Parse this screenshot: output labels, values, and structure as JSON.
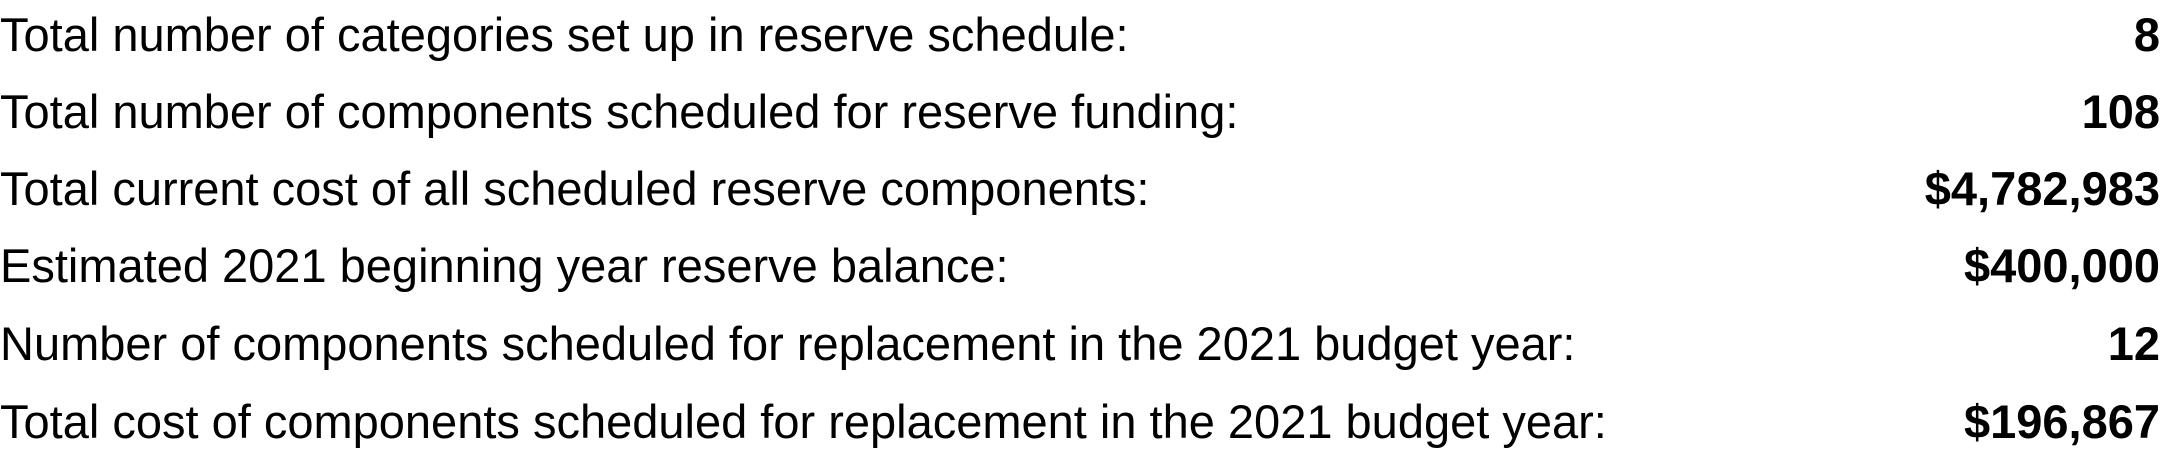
{
  "rows": [
    {
      "label": "Total number of categories set up in reserve schedule:",
      "value": "8"
    },
    {
      "label": "Total number of components scheduled for reserve funding:",
      "value": "108"
    },
    {
      "label": "Total current cost of all scheduled reserve components:",
      "value": "$4,782,983"
    },
    {
      "label": "Estimated 2021 beginning year reserve balance:",
      "value": "$400,000"
    },
    {
      "label": "Number of components scheduled for replacement in the 2021 budget year:",
      "value": "12"
    },
    {
      "label": "Total cost of components scheduled for replacement in the 2021 budget year:",
      "value": "$196,867"
    }
  ]
}
